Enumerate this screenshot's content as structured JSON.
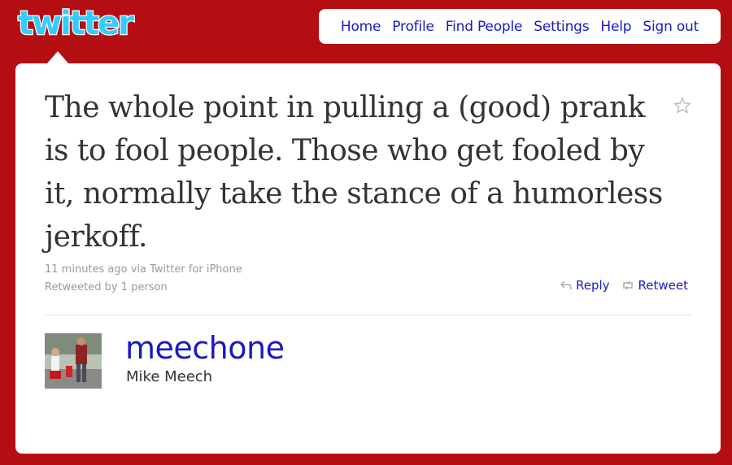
{
  "logo": {
    "text": "twitter"
  },
  "nav": {
    "items": [
      {
        "label": "Home"
      },
      {
        "label": "Profile"
      },
      {
        "label": "Find People"
      },
      {
        "label": "Settings"
      },
      {
        "label": "Help"
      },
      {
        "label": "Sign out"
      }
    ]
  },
  "tweet": {
    "text": "The whole point in pulling a (good) prank is to fool people. Those who get fooled by it, normally take the stance of a humorless jerkoff.",
    "timestamp": "11 minutes ago via Twitter for iPhone",
    "retweeted_by": "Retweeted by 1 person",
    "favorite_icon": "star-icon",
    "actions": {
      "reply_label": "Reply",
      "retweet_label": "Retweet"
    }
  },
  "user": {
    "handle": "meechone",
    "name": "Mike Meech"
  },
  "colors": {
    "background": "#b30f12",
    "link": "#1a1abf",
    "logo": "#33ccff",
    "text": "#333333",
    "meta": "#999999"
  }
}
